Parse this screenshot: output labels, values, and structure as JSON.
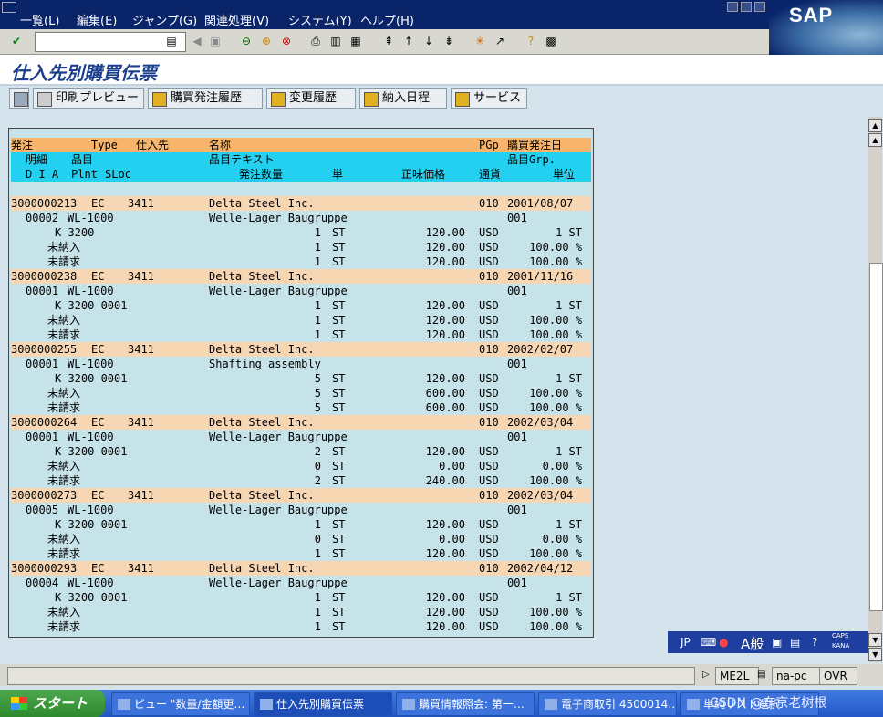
{
  "menubar": {
    "items": [
      "一覧(L)",
      "編集(E)",
      "ジャンプ(G)",
      "関連処理(V)",
      "システム(Y)",
      "ヘルプ(H)"
    ]
  },
  "logo_text": "SAP",
  "toolbar": {
    "command_value": ""
  },
  "title": "仕入先別購買伝票",
  "app_toolbar": {
    "buttons": [
      "印刷プレビュー",
      "購買発注履歴",
      "変更履歴",
      "納入日程",
      "サービス"
    ]
  },
  "list": {
    "header1": {
      "po": "発注",
      "type": "Type",
      "vendor": "仕入先",
      "name": "名称",
      "pgp": "PGp",
      "date": "購買発注日"
    },
    "header2": {
      "item": "明細",
      "material": "品目",
      "text": "品目テキスト",
      "grp": "品目Grp."
    },
    "header3": {
      "dia": "D I A",
      "plnt": "Plnt",
      "sloc": "SLoc",
      "qty": "発注数量",
      "unit": "単",
      "price": "正味価格",
      "curr": "通貨",
      "per": "単位"
    },
    "orders": [
      {
        "po": "3000000213",
        "type": "EC",
        "vendor": "3411",
        "name": "Delta Steel Inc.",
        "pgp": "010",
        "date": "2001/08/07",
        "item": "00002",
        "material": "WL-1000",
        "text": "Welle-Lager Baugruppe",
        "grp": "001",
        "acct": "K 3200",
        "l1": {
          "qty": "1",
          "unit": "ST",
          "price": "120.00",
          "curr": "USD",
          "per": "1 ST"
        },
        "l2": {
          "label": "未納入",
          "qty": "1",
          "unit": "ST",
          "price": "120.00",
          "curr": "USD",
          "per": "100.00 %"
        },
        "l3": {
          "label": "未請求",
          "qty": "1",
          "unit": "ST",
          "price": "120.00",
          "curr": "USD",
          "per": "100.00 %"
        }
      },
      {
        "po": "3000000238",
        "type": "EC",
        "vendor": "3411",
        "name": "Delta Steel Inc.",
        "pgp": "010",
        "date": "2001/11/16",
        "item": "00001",
        "material": "WL-1000",
        "text": "Welle-Lager Baugruppe",
        "grp": "001",
        "acct": "K 3200 0001",
        "l1": {
          "qty": "1",
          "unit": "ST",
          "price": "120.00",
          "curr": "USD",
          "per": "1 ST"
        },
        "l2": {
          "label": "未納入",
          "qty": "1",
          "unit": "ST",
          "price": "120.00",
          "curr": "USD",
          "per": "100.00 %"
        },
        "l3": {
          "label": "未請求",
          "qty": "1",
          "unit": "ST",
          "price": "120.00",
          "curr": "USD",
          "per": "100.00 %"
        }
      },
      {
        "po": "3000000255",
        "type": "EC",
        "vendor": "3411",
        "name": "Delta Steel Inc.",
        "pgp": "010",
        "date": "2002/02/07",
        "item": "00001",
        "material": "WL-1000",
        "text": "Shafting assembly",
        "grp": "001",
        "acct": "K 3200 0001",
        "l1": {
          "qty": "5",
          "unit": "ST",
          "price": "120.00",
          "curr": "USD",
          "per": "1 ST"
        },
        "l2": {
          "label": "未納入",
          "qty": "5",
          "unit": "ST",
          "price": "600.00",
          "curr": "USD",
          "per": "100.00 %"
        },
        "l3": {
          "label": "未請求",
          "qty": "5",
          "unit": "ST",
          "price": "600.00",
          "curr": "USD",
          "per": "100.00 %"
        }
      },
      {
        "po": "3000000264",
        "type": "EC",
        "vendor": "3411",
        "name": "Delta Steel Inc.",
        "pgp": "010",
        "date": "2002/03/04",
        "item": "00001",
        "material": "WL-1000",
        "text": "Welle-Lager Baugruppe",
        "grp": "001",
        "acct": "K 3200 0001",
        "l1": {
          "qty": "2",
          "unit": "ST",
          "price": "120.00",
          "curr": "USD",
          "per": "1 ST"
        },
        "l2": {
          "label": "未納入",
          "qty": "0",
          "unit": "ST",
          "price": "0.00",
          "curr": "USD",
          "per": "0.00 %"
        },
        "l3": {
          "label": "未請求",
          "qty": "2",
          "unit": "ST",
          "price": "240.00",
          "curr": "USD",
          "per": "100.00 %"
        }
      },
      {
        "po": "3000000273",
        "type": "EC",
        "vendor": "3411",
        "name": "Delta Steel Inc.",
        "pgp": "010",
        "date": "2002/03/04",
        "item": "00005",
        "material": "WL-1000",
        "text": "Welle-Lager Baugruppe",
        "grp": "001",
        "acct": "K 3200 0001",
        "l1": {
          "qty": "1",
          "unit": "ST",
          "price": "120.00",
          "curr": "USD",
          "per": "1 ST"
        },
        "l2": {
          "label": "未納入",
          "qty": "0",
          "unit": "ST",
          "price": "0.00",
          "curr": "USD",
          "per": "0.00 %"
        },
        "l3": {
          "label": "未請求",
          "qty": "1",
          "unit": "ST",
          "price": "120.00",
          "curr": "USD",
          "per": "100.00 %"
        }
      },
      {
        "po": "3000000293",
        "type": "EC",
        "vendor": "3411",
        "name": "Delta Steel Inc.",
        "pgp": "010",
        "date": "2002/04/12",
        "item": "00004",
        "material": "WL-1000",
        "text": "Welle-Lager Baugruppe",
        "grp": "001",
        "acct": "K 3200 0001",
        "l1": {
          "qty": "1",
          "unit": "ST",
          "price": "120.00",
          "curr": "USD",
          "per": "1 ST"
        },
        "l2": {
          "label": "未納入",
          "qty": "1",
          "unit": "ST",
          "price": "120.00",
          "curr": "USD",
          "per": "100.00 %"
        },
        "l3": {
          "label": "未請求",
          "qty": "1",
          "unit": "ST",
          "price": "120.00",
          "curr": "USD",
          "per": "100.00 %"
        }
      }
    ]
  },
  "ime": {
    "lang": "JP",
    "mode": "A般",
    "caps": "CAPS",
    "kana": "KANA"
  },
  "status": {
    "transaction": "ME2L",
    "server": "na-pc",
    "mode": "OVR"
  },
  "taskbar": {
    "start": "スタート",
    "tasks": [
      "ビュー \"数量/金額更…",
      "仕入先別購買伝票",
      "購買情報照会: 第一…",
      "電子商取引 4500014…",
      "単純リスト選択"
    ]
  },
  "watermark": "CSDN @东京老树根"
}
